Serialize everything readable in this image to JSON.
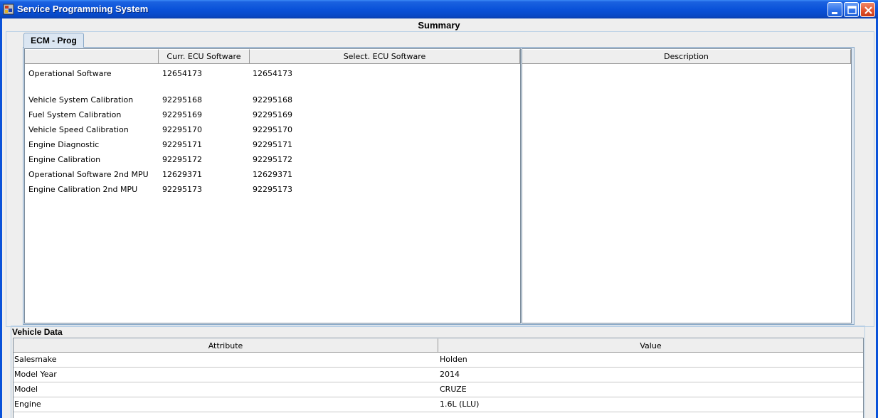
{
  "window": {
    "title": "Service Programming System"
  },
  "summary": {
    "heading": "Summary"
  },
  "tabs": [
    {
      "label": "ECM - Prog",
      "selected": true
    }
  ],
  "ecu_table": {
    "columns": [
      "",
      "Curr. ECU Software",
      "Select. ECU Software"
    ],
    "rows": [
      {
        "name": "Operational Software",
        "current": "12654173",
        "selected": "12654173"
      },
      {
        "name": "Vehicle System Calibration",
        "current": "92295168",
        "selected": "92295168"
      },
      {
        "name": "Fuel System Calibration",
        "current": "92295169",
        "selected": "92295169"
      },
      {
        "name": "Vehicle Speed Calibration",
        "current": "92295170",
        "selected": "92295170"
      },
      {
        "name": "Engine Diagnostic",
        "current": "92295171",
        "selected": "92295171"
      },
      {
        "name": "Engine Calibration",
        "current": "92295172",
        "selected": "92295172"
      },
      {
        "name": "Operational Software 2nd MPU",
        "current": "12629371",
        "selected": "12629371"
      },
      {
        "name": "Engine Calibration 2nd MPU",
        "current": "92295173",
        "selected": "92295173"
      }
    ]
  },
  "description_panel": {
    "header": "Description"
  },
  "vehicle_data": {
    "title": "Vehicle Data",
    "columns": [
      "Attribute",
      "Value"
    ],
    "rows": [
      {
        "attribute": "Salesmake",
        "value": "Holden"
      },
      {
        "attribute": "Model Year",
        "value": "2014"
      },
      {
        "attribute": "Model",
        "value": "CRUZE"
      },
      {
        "attribute": "Engine",
        "value": "1.6L (LLU)"
      }
    ]
  }
}
